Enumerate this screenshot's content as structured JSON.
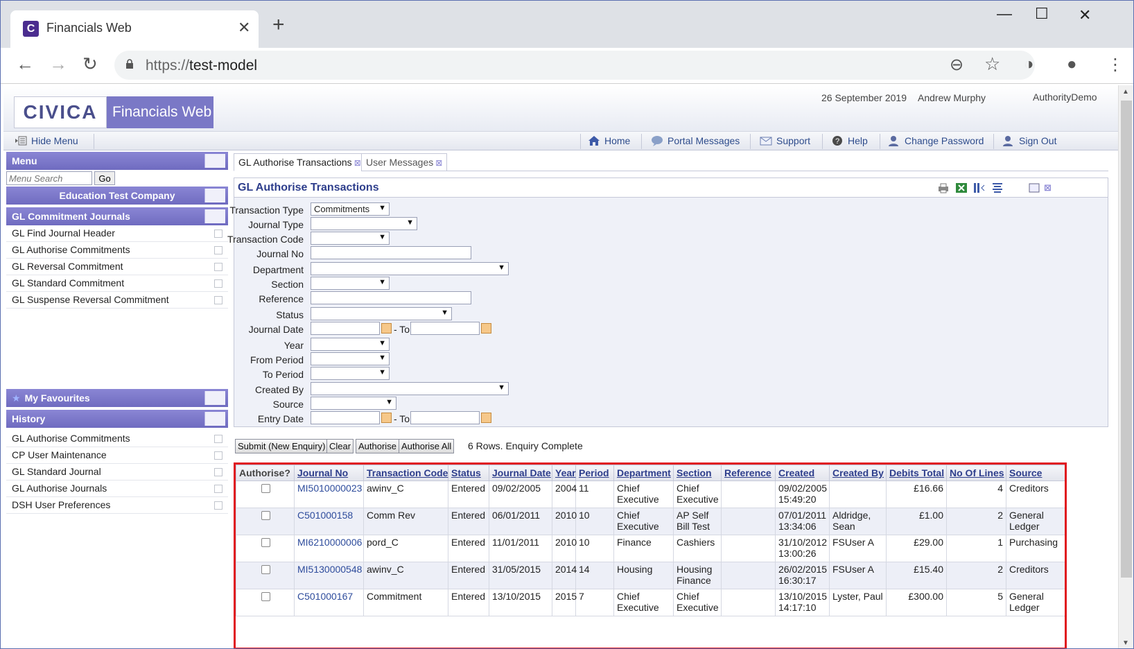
{
  "browser": {
    "tab_title": "Financials Web",
    "url_scheme": "https://",
    "url_host": "test-model"
  },
  "header": {
    "logo": "CIVICA",
    "product": "Financials Web",
    "date": "26 September 2019",
    "user": "Andrew Murphy",
    "authority": "AuthorityDemo"
  },
  "nav": {
    "hide_menu": "Hide Menu",
    "home": "Home",
    "portal_messages": "Portal Messages",
    "support": "Support",
    "help": "Help",
    "change_password": "Change Password",
    "sign_out": "Sign Out"
  },
  "sidebar": {
    "menu_title": "Menu",
    "search_placeholder": "Menu Search",
    "go": "Go",
    "company": "Education Test Company",
    "section": "GL Commitment Journals",
    "items": [
      "GL Find Journal Header",
      "GL Authorise Commitments",
      "GL Reversal Commitment",
      "GL Standard Commitment",
      "GL Suspense Reversal Commitment"
    ],
    "favourites_title": "My Favourites",
    "history_title": "History",
    "history": [
      "GL Authorise Commitments",
      "CP User Maintenance",
      "GL Standard Journal",
      "GL Authorise Journals",
      "DSH User Preferences"
    ]
  },
  "tabs": {
    "active": "GL Authorise Transactions",
    "other": "User Messages"
  },
  "panel": {
    "title": "GL Authorise Transactions"
  },
  "form": {
    "transaction_type": {
      "label": "Transaction Type",
      "value": "Commitments"
    },
    "journal_type": {
      "label": "Journal Type"
    },
    "transaction_code": {
      "label": "Transaction Code"
    },
    "journal_no": {
      "label": "Journal No"
    },
    "department": {
      "label": "Department"
    },
    "section": {
      "label": "Section"
    },
    "reference": {
      "label": "Reference"
    },
    "status": {
      "label": "Status"
    },
    "journal_date": {
      "label": "Journal Date"
    },
    "year": {
      "label": "Year"
    },
    "from_period": {
      "label": "From Period"
    },
    "to_period": {
      "label": "To Period"
    },
    "created_by": {
      "label": "Created By"
    },
    "source": {
      "label": "Source"
    },
    "entry_date": {
      "label": "Entry Date"
    },
    "to_label": "- To"
  },
  "actions": {
    "submit": "Submit (New Enquiry)",
    "clear": "Clear",
    "authorise": "Authorise",
    "authorise_all": "Authorise All",
    "message": "6 Rows. Enquiry Complete"
  },
  "grid": {
    "headers": [
      "Authorise?",
      "Journal No",
      "Transaction Code",
      "Status",
      "Journal Date",
      "Year",
      "Period",
      "Department",
      "Section",
      "Reference",
      "Created",
      "Created By",
      "Debits Total",
      "No Of Lines",
      "Source"
    ],
    "rows": [
      {
        "journal_no": "MI5010000023",
        "code": "awinv_C",
        "status": "Entered",
        "jdate": "09/02/2005",
        "year": "2004",
        "period": "11",
        "dept": "Chief Executive",
        "section": "Chief Executive",
        "reference": "",
        "created_date": "09/02/2005",
        "created_time": "15:49:20",
        "created_by": "",
        "debits": "£16.66",
        "lines": "4",
        "source": "Creditors"
      },
      {
        "journal_no": "C501000158",
        "code": "Comm Rev",
        "status": "Entered",
        "jdate": "06/01/2011",
        "year": "2010",
        "period": "10",
        "dept": "Chief Executive",
        "section": "AP Self Bill Test",
        "reference": "",
        "created_date": "07/01/2011",
        "created_time": "13:34:06",
        "created_by": "Aldridge, Sean",
        "debits": "£1.00",
        "lines": "2",
        "source": "General Ledger"
      },
      {
        "journal_no": "MI6210000006",
        "code": "pord_C",
        "status": "Entered",
        "jdate": "11/01/2011",
        "year": "2010",
        "period": "10",
        "dept": "Finance",
        "section": "Cashiers",
        "reference": "",
        "created_date": "31/10/2012",
        "created_time": "13:00:26",
        "created_by": "FSUser A",
        "debits": "£29.00",
        "lines": "1",
        "source": "Purchasing"
      },
      {
        "journal_no": "MI5130000548",
        "code": "awinv_C",
        "status": "Entered",
        "jdate": "31/05/2015",
        "year": "2014",
        "period": "14",
        "dept": "Housing",
        "section": "Housing Finance",
        "reference": "",
        "created_date": "26/02/2015",
        "created_time": "16:30:17",
        "created_by": "FSUser A",
        "debits": "£15.40",
        "lines": "2",
        "source": "Creditors"
      },
      {
        "journal_no": "C501000167",
        "code": "Commitment",
        "status": "Entered",
        "jdate": "13/10/2015",
        "year": "2015",
        "period": "7",
        "dept": "Chief Executive",
        "section": "Chief Executive",
        "reference": "",
        "created_date": "13/10/2015",
        "created_time": "14:17:10",
        "created_by": "Lyster, Paul",
        "debits": "£300.00",
        "lines": "5",
        "source": "General Ledger"
      }
    ]
  },
  "colors": {
    "accent": "#7a78c6",
    "title_blue": "#2e3e8c",
    "highlight": "#e0141e"
  }
}
